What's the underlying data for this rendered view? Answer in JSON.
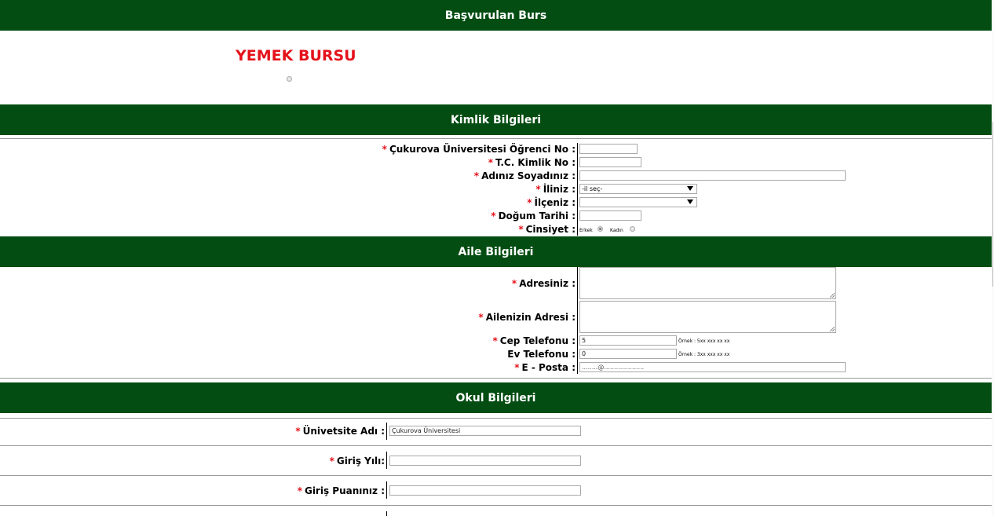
{
  "sections": {
    "scholarship": "Başvurulan Burs",
    "identity": "Kimlik Bilgileri",
    "family": "Aile Bilgileri",
    "school": "Okul Bilgileri"
  },
  "scholarship": {
    "name": "YEMEK BURSU"
  },
  "required_mark": "*",
  "identity": {
    "student_no": {
      "label": "Çukurova Üniversitesi Öğrenci No :",
      "value": ""
    },
    "tc_no": {
      "label": "T.C. Kimlik No :",
      "value": ""
    },
    "full_name": {
      "label": "Adınız Soyadınız :",
      "value": ""
    },
    "province": {
      "label": "İliniz :",
      "selected": "-il seç-"
    },
    "district": {
      "label": "İlçeniz :",
      "selected": ""
    },
    "birth_date": {
      "label": "Doğum Tarihi :",
      "value": ""
    },
    "gender": {
      "label": "Cinsiyet :",
      "male": "Erkek",
      "female": "Kadın",
      "selected": "Erkek"
    }
  },
  "family": {
    "address": {
      "label": "Adresiniz :",
      "value": ""
    },
    "family_address": {
      "label": "Ailenizin Adresi :",
      "value": ""
    },
    "mobile": {
      "label": "Cep Telefonu :",
      "value": "5",
      "hint": "Örnek : 5xx xxx xx xx"
    },
    "home_phone": {
      "label": "Ev Telefonu :",
      "value": "0",
      "hint": "Örnek : 3xx xxx xx xx"
    },
    "email": {
      "label": "E - Posta :",
      "value": "........@...................."
    }
  },
  "school": {
    "university": {
      "label": "Ünivetsite Adı :",
      "value": "Çukurova Üniversitesi"
    },
    "entry_year": {
      "label": "Giriş Yılı:",
      "value": ""
    },
    "entry_score": {
      "label": "Giriş Puanınız :",
      "value": ""
    }
  }
}
